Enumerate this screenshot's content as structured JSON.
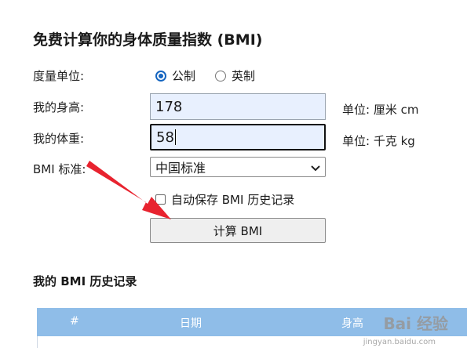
{
  "title": "免费计算你的身体质量指数 (BMI)",
  "form": {
    "unit_label": "度量单位:",
    "units": [
      {
        "label": "公制",
        "checked": true
      },
      {
        "label": "英制",
        "checked": false
      }
    ],
    "height_label": "我的身高:",
    "height_value": "178",
    "height_unit": "单位: 厘米 cm",
    "weight_label": "我的体重:",
    "weight_value": "58",
    "weight_unit": "单位: 千克 kg",
    "standard_label": "BMI 标准:",
    "standard_value": "中国标准",
    "autosave_label": "自动保存 BMI 历史记录",
    "calc_button": "计算 BMI"
  },
  "history": {
    "title": "我的 BMI 历史记录",
    "columns": [
      "#",
      "日期",
      "身高"
    ]
  },
  "watermark": {
    "main": "Bai 经验",
    "sub": "jingyan.baidu.com"
  },
  "colors": {
    "arrow": "#e8232f",
    "table_header": "#8fbde8",
    "input_bg": "#e8f0fe",
    "radio_accent": "#1565c0"
  }
}
